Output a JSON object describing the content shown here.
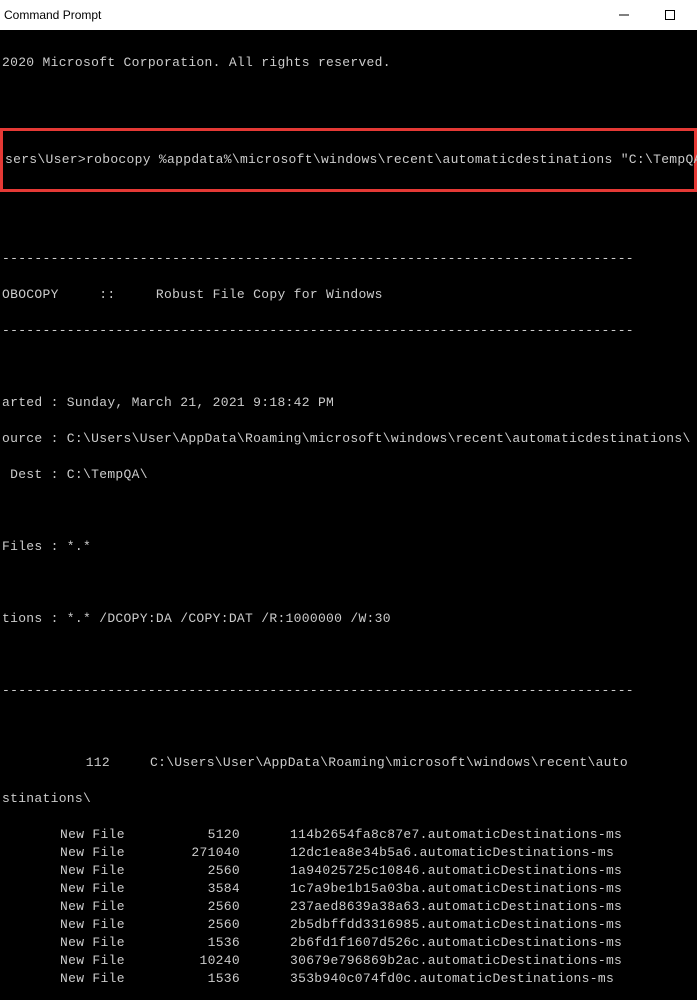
{
  "window": {
    "title": "Command Prompt"
  },
  "copyright": "2020 Microsoft Corporation. All rights reserved.",
  "prompt": {
    "path": "sers\\User>",
    "command": "robocopy %appdata%\\microsoft\\windows\\recent\\automaticdestinations \"C:\\TempQA\""
  },
  "header": {
    "program": "OBOCOPY     ::     Robust File Copy for Windows"
  },
  "meta": {
    "started": "arted : Sunday, March 21, 2021 9:18:42 PM",
    "source": "ource : C:\\Users\\User\\AppData\\Roaming\\microsoft\\windows\\recent\\automaticdestinations\\",
    "dest": " Dest : C:\\TempQA\\",
    "files": "Files : *.*",
    "options": "tions : *.* /DCOPY:DA /COPY:DAT /R:1000000 /W:30"
  },
  "dashes": "------------------------------------------------------------------------------",
  "directory": {
    "count": "112",
    "path": "C:\\Users\\User\\AppData\\Roaming\\microsoft\\windows\\recent\\auto",
    "cont": "stinations\\"
  },
  "files": [
    {
      "label": "New File",
      "size": "5120",
      "name": "114b2654fa8c87e7.automaticDestinations-ms"
    },
    {
      "label": "New File",
      "size": "271040",
      "name": "12dc1ea8e34b5a6.automaticDestinations-ms"
    },
    {
      "label": "New File",
      "size": "2560",
      "name": "1a94025725c10846.automaticDestinations-ms"
    },
    {
      "label": "New File",
      "size": "3584",
      "name": "1c7a9be1b15a03ba.automaticDestinations-ms"
    },
    {
      "label": "New File",
      "size": "2560",
      "name": "237aed8639a38a63.automaticDestinations-ms"
    },
    {
      "label": "New File",
      "size": "2560",
      "name": "2b5dbffdd3316985.automaticDestinations-ms"
    },
    {
      "label": "New File",
      "size": "1536",
      "name": "2b6fd1f1607d526c.automaticDestinations-ms"
    },
    {
      "label": "New File",
      "size": "10240",
      "name": "30679e796869b2ac.automaticDestinations-ms"
    },
    {
      "label": "New File",
      "size": "1536",
      "name": "353b940c074fd0c.automaticDestinations-ms"
    }
  ]
}
